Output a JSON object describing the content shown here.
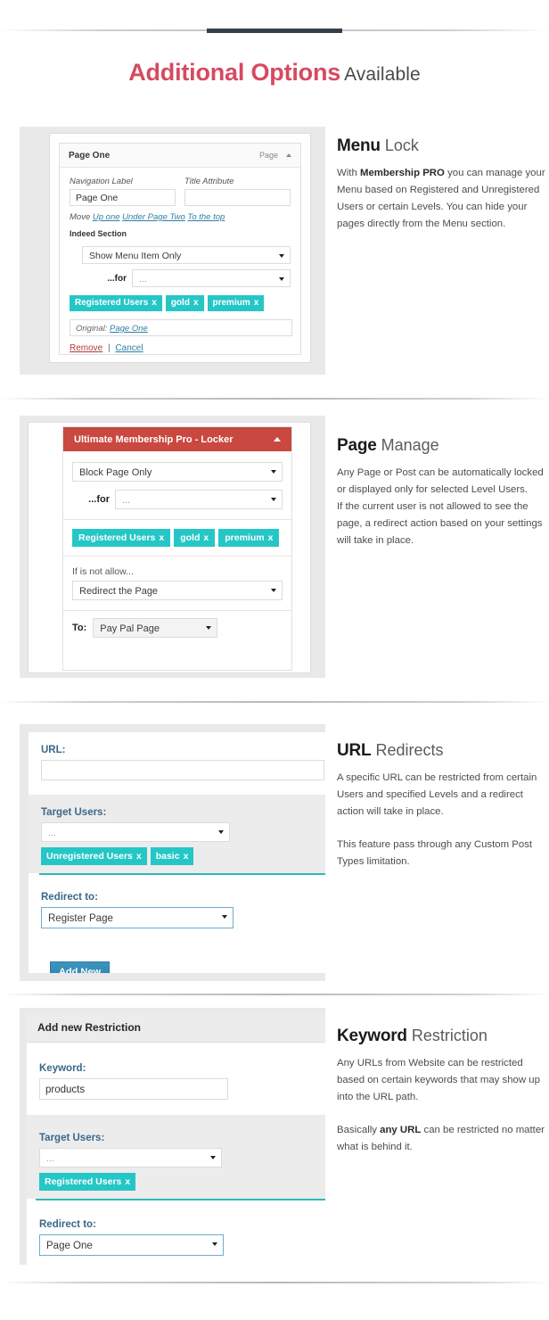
{
  "header": {
    "title_strong": "Additional Options",
    "title_light": "Available"
  },
  "features": [
    {
      "heading_bold": "Menu",
      "heading_light": "Lock",
      "paragraphs": [
        {
          "lead": "With ",
          "bold": "Membership PRO",
          "rest": " you can manage your Menu based on Registered and Unregistered Users or certain Levels. You can hide your pages directly from the Menu section."
        }
      ],
      "shot": {
        "panel_title": "Page One",
        "panel_type": "Page",
        "label_nav": "Navigation Label",
        "label_title_attr": "Title Attribute",
        "value_nav": "Page One",
        "value_title_attr": "",
        "move_label": "Move",
        "move_links": [
          "Up one",
          "Under Page Two",
          "To the top"
        ],
        "section_label": "Indeed Section",
        "select_action": "Show Menu Item Only",
        "for_label": "...for",
        "select_for": "...",
        "tags": [
          "Registered Users",
          "gold",
          "premium"
        ],
        "original_label": "Original:",
        "original_value": "Page One",
        "remove_label": "Remove",
        "separator": "|",
        "cancel_label": "Cancel"
      }
    },
    {
      "heading_bold": "Page",
      "heading_light": "Manage",
      "paragraphs": [
        {
          "lead": "Any Page or Post can be automatically locked or displayed only for selected Level Users.",
          "bold": "",
          "rest": ""
        },
        {
          "lead": "If the current user is not allowed to see the page, a redirect action based on your settings will take in place.",
          "bold": "",
          "rest": ""
        }
      ],
      "shot": {
        "panel_title": "Ultimate Membership Pro - Locker",
        "select_action": "Block Page Only",
        "for_label": "...for",
        "select_for": "...",
        "tags": [
          "Registered Users",
          "gold",
          "premium"
        ],
        "not_allow_label": "If is not allow...",
        "select_redirect": "Redirect the Page",
        "to_label": "To:",
        "select_to": "Pay Pal Page"
      }
    },
    {
      "heading_bold": "URL",
      "heading_light": "Redirects",
      "paragraphs": [
        {
          "lead": "A specific URL can be restricted from certain Users and specified Levels and a redirect action will take in place.",
          "bold": "",
          "rest": ""
        },
        {
          "lead": "This feature pass through any Custom Post Types limitation.",
          "bold": "",
          "rest": ""
        }
      ],
      "shot": {
        "url_label": "URL:",
        "url_value": "",
        "target_label": "Target Users:",
        "target_select": "...",
        "tags": [
          "Unregistered Users",
          "basic"
        ],
        "redirect_label": "Redirect to:",
        "redirect_select": "Register Page",
        "add_button": "Add New"
      }
    },
    {
      "heading_bold": "Keyword",
      "heading_light": "Restriction",
      "paragraphs": [
        {
          "lead": "Any URLs from Website can be restricted based on certain keywords that may show up into the URL path.",
          "bold": "",
          "rest": ""
        },
        {
          "lead": "Basically ",
          "bold": "any URL",
          "rest": " can be restricted no matter what is behind it."
        }
      ],
      "shot": {
        "panel_title": "Add new Restriction",
        "keyword_label": "Keyword:",
        "keyword_value": "products",
        "target_label": "Target Users:",
        "target_select": "...",
        "tags": [
          "Registered Users"
        ],
        "redirect_label": "Redirect to:",
        "redirect_select": "Page One"
      }
    }
  ],
  "colors": {
    "accent_red": "#d64a60",
    "teal_tag": "#25c6c6",
    "locker_red": "#c9483f",
    "label_blue": "#39688a",
    "button_blue": "#2e82ad",
    "rule_dark": "#343f4a"
  }
}
